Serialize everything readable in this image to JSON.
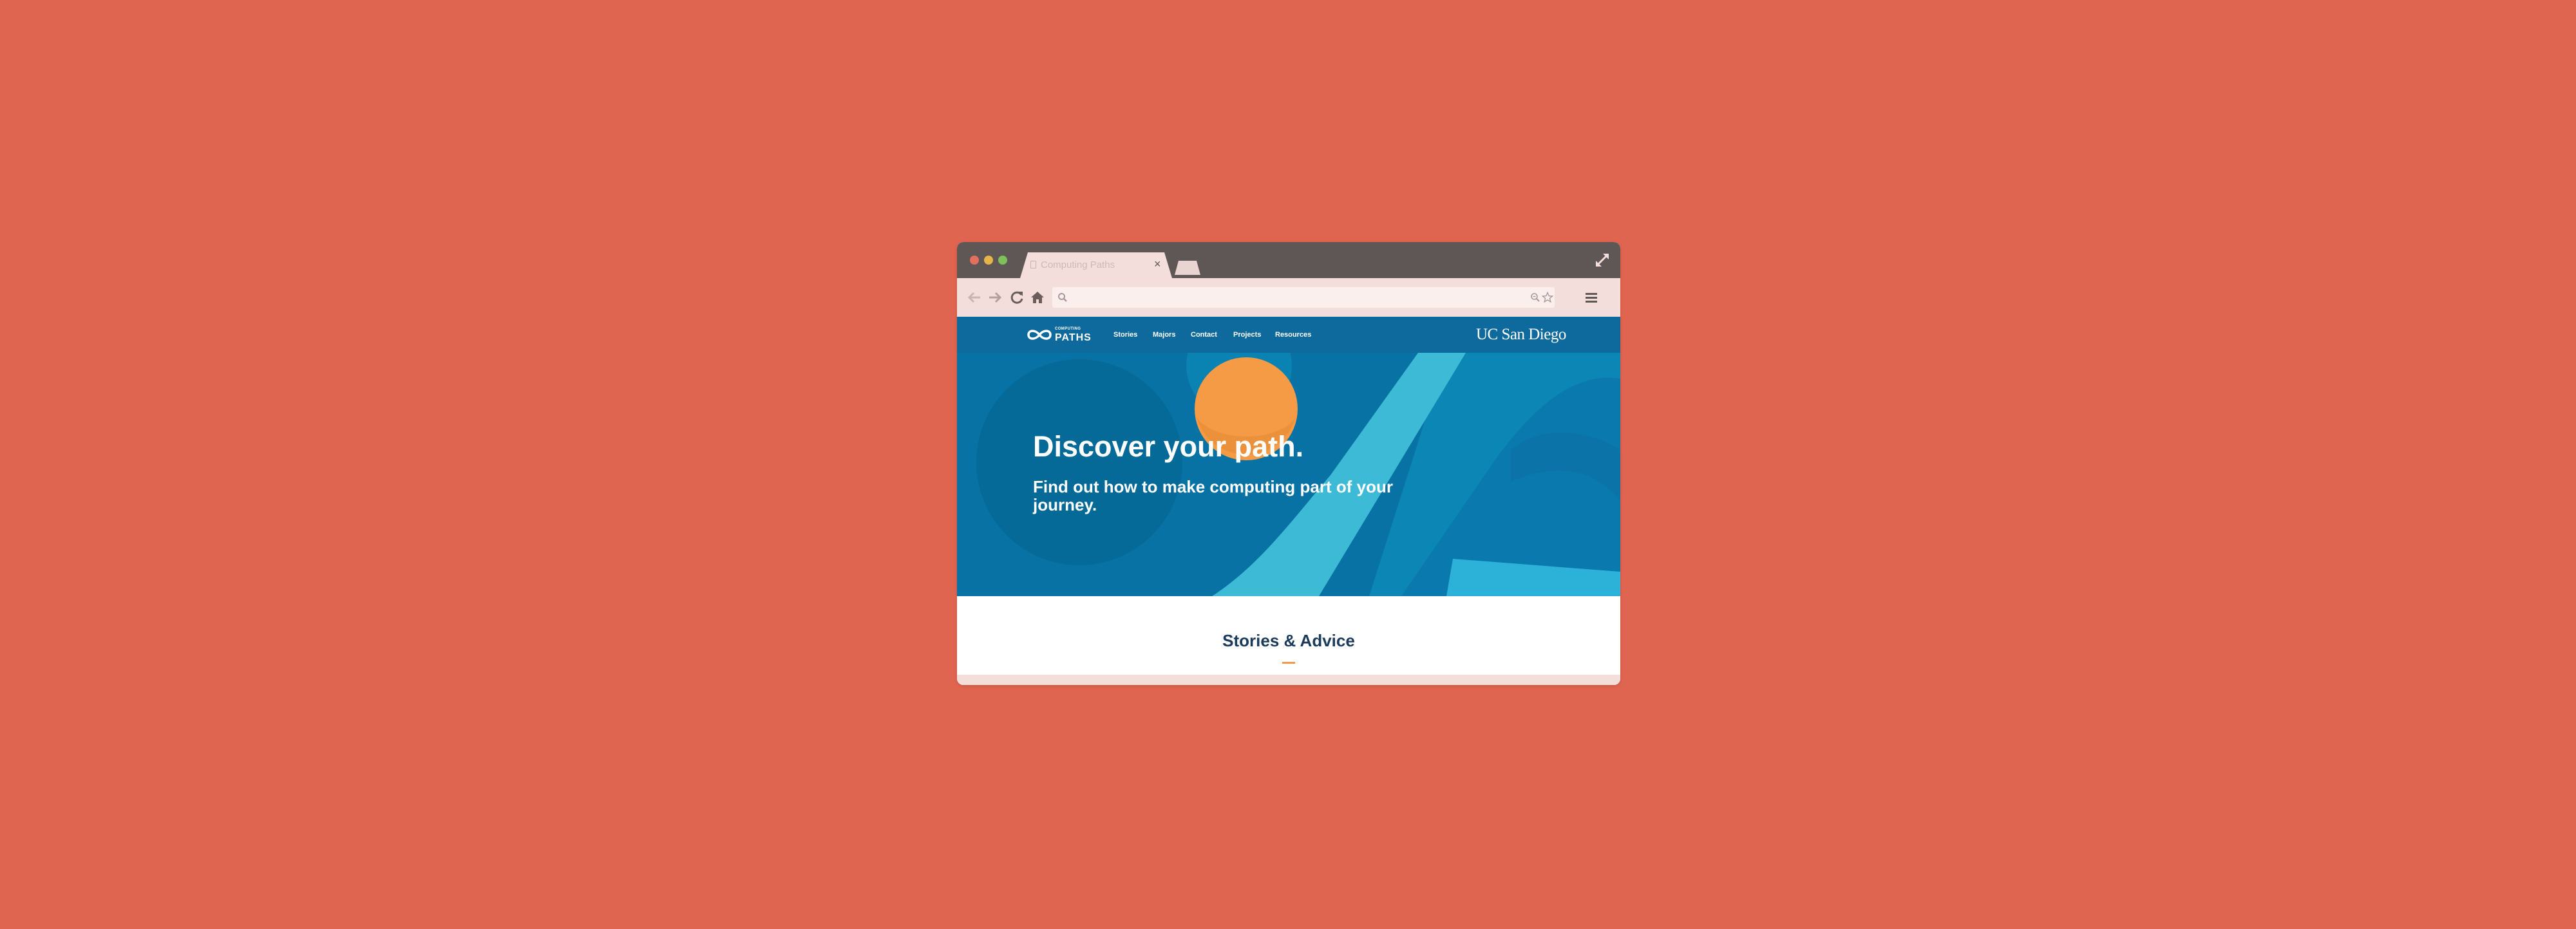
{
  "browser": {
    "tab_title": "Computing Paths",
    "tab_close": "×",
    "address_value": "",
    "icons": [
      "back-arrow-icon",
      "forward-arrow-icon",
      "reload-icon",
      "home-icon",
      "search-icon",
      "zoom-icon",
      "star-icon",
      "hamburger-menu-icon",
      "fullscreen-icon"
    ]
  },
  "site": {
    "logo_small": "COMPUTING",
    "logo_big": "PATHS",
    "nav": [
      "Stories",
      "Majors",
      "Contact",
      "Projects",
      "Resources"
    ],
    "partner_logo": "UC San Diego",
    "hero_title": "Discover your path.",
    "hero_subtitle": "Find out how to make computing part of your journey.",
    "section_title": "Stories & Advice"
  },
  "colors": {
    "background": "#e06550",
    "titlebar": "#5f5755",
    "toolbar": "#f3dedc",
    "nav_blue": "#0e6a9c",
    "hero_blue": "#0872a4",
    "accent_orange": "#f59b45",
    "light_blue": "#3dbbd6",
    "heading_navy": "#1b3a5c"
  }
}
